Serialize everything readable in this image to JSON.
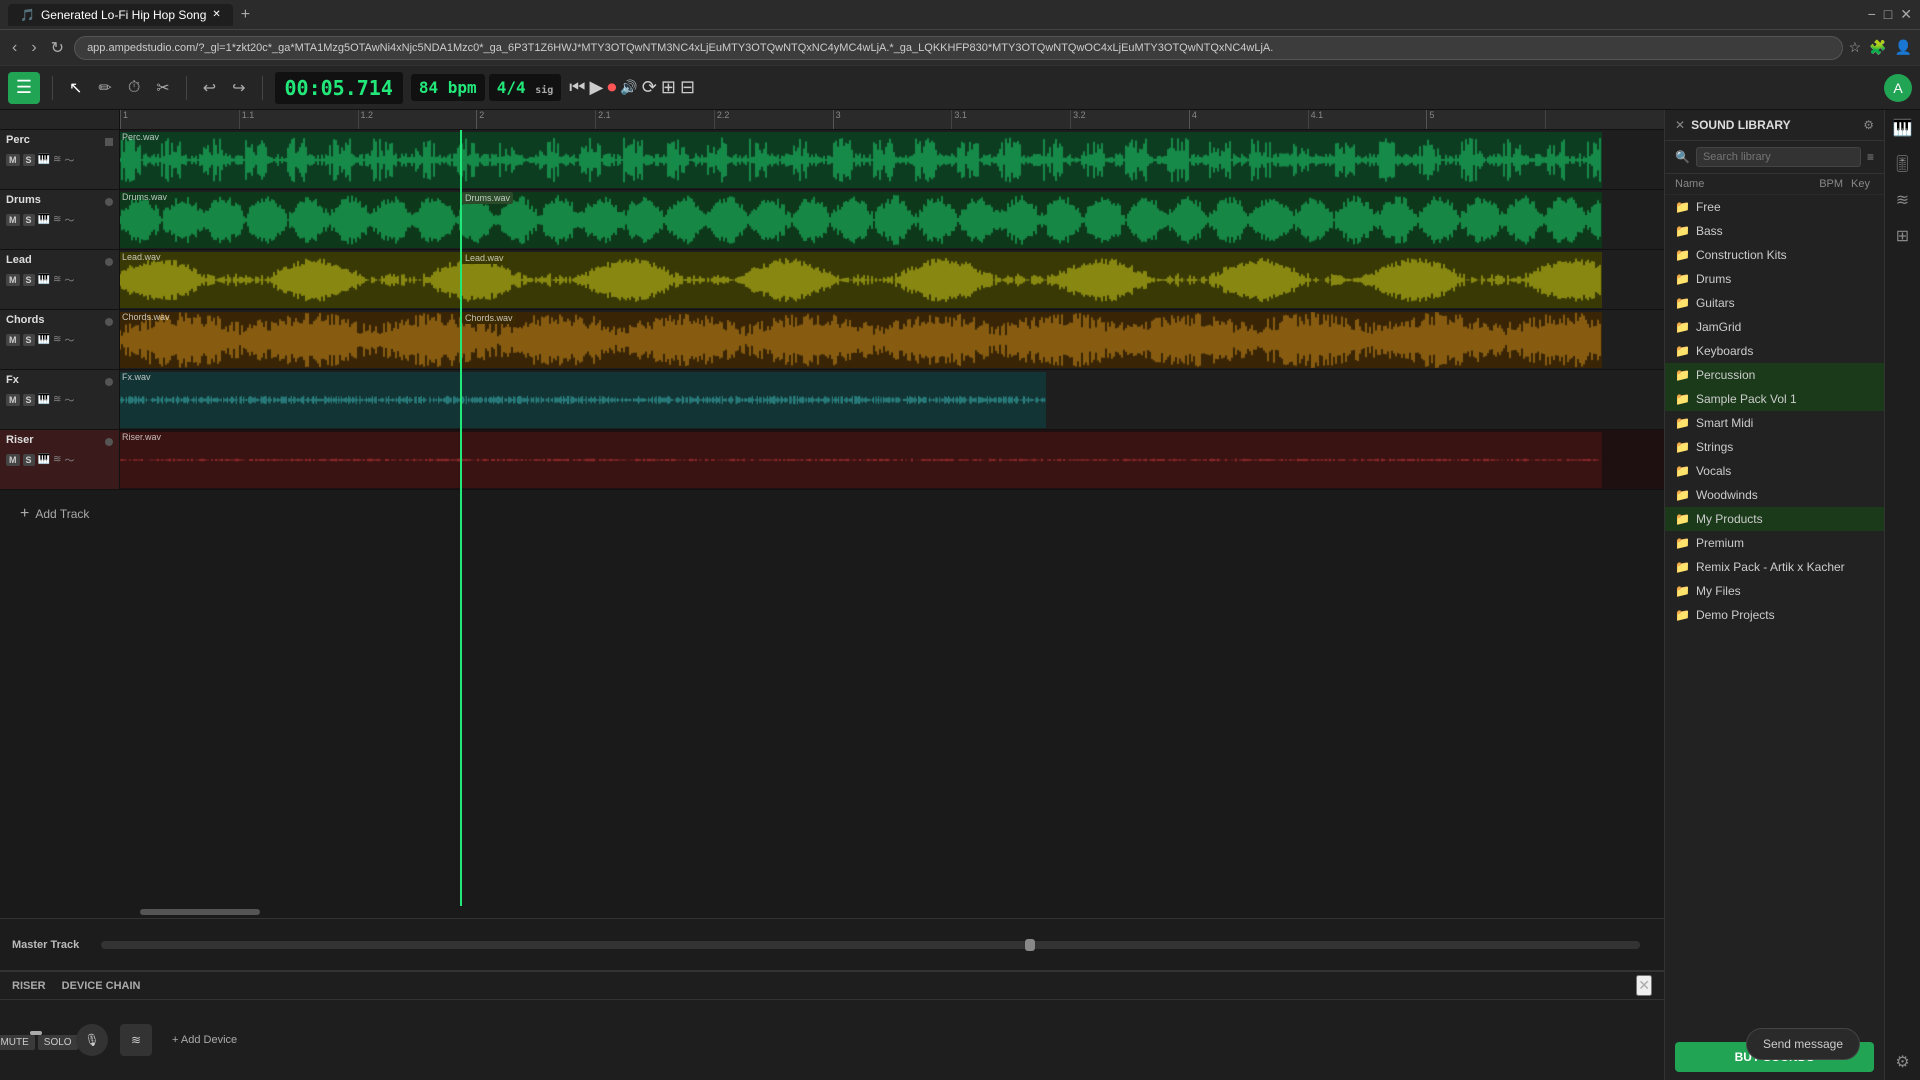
{
  "browser": {
    "tab_label": "Generated Lo-Fi Hip Hop Song",
    "url": "app.ampedstudio.com/?_gl=1*zkt20c*_ga*MTA1Mzg5OTAwNi4xNjc5NDA1Mzc0*_ga_6P3T1Z6HWJ*MTY3OTQwNTM3NC4xLjEuMTY3OTQwNTQxNC4yMC4wLjA.*_ga_LQKKHFP830*MTY3OTQwNTQwOC4xLjEuMTY3OTQwNTQxNC4wLjA.",
    "new_tab": "+",
    "minimize": "−",
    "maximize": "□",
    "close": "✕"
  },
  "toolbar": {
    "menu_icon": "☰",
    "select_tool": "↖",
    "pencil_tool": "✏",
    "time_tool": "⏱",
    "cut_tool": "✂",
    "undo": "↩",
    "redo": "↪",
    "time_display": "00:05.714",
    "bpm_label": "84 bpm",
    "sig_label": "4/4",
    "sig_sub": "sig",
    "rewind": "⏮",
    "play": "▶",
    "record": "⏺",
    "loop": "🔁",
    "metronome": "🎵",
    "grid": "⊞"
  },
  "tracks": [
    {
      "id": "perc",
      "name": "Perc",
      "clip_label": "Perc.wav",
      "type": "perc",
      "color": "#22e87a",
      "has_second_clip": false
    },
    {
      "id": "drums",
      "name": "Drums",
      "clip_label": "Drums.wav",
      "type": "drums",
      "color": "#22e87a",
      "has_second_clip": true,
      "second_clip_label": "Drums.wav"
    },
    {
      "id": "lead",
      "name": "Lead",
      "clip_label": "Lead.wav",
      "type": "lead",
      "color": "#e8e822",
      "has_second_clip": true,
      "second_clip_label": "Lead.wav"
    },
    {
      "id": "chords",
      "name": "Chords",
      "clip_label": "Chords.wav",
      "type": "chords",
      "color": "#e8a022",
      "has_second_clip": true,
      "second_clip_label": "Chords.wav"
    },
    {
      "id": "fx",
      "name": "Fx",
      "clip_label": "Fx.wav",
      "type": "fx",
      "color": "#44cccc",
      "has_second_clip": false
    },
    {
      "id": "riser",
      "name": "Riser",
      "clip_label": "Riser.wav",
      "type": "riser",
      "color": "#e84444",
      "has_second_clip": false,
      "selected": true
    }
  ],
  "add_track": {
    "icon": "+",
    "label": "Add Track"
  },
  "master_track": {
    "label": "Master Track"
  },
  "bottom_panel": {
    "track_label": "RISER",
    "device_chain_label": "DEVICE CHAIN",
    "close_icon": "✕",
    "mute_label": "MUTE",
    "solo_label": "SOLO",
    "add_device_label": "+ Add Device"
  },
  "sound_library": {
    "title": "SOUND LIBRARY",
    "close_icon": "✕",
    "search_placeholder": "Search library",
    "col_name": "Name",
    "col_bpm": "BPM",
    "col_key": "Key",
    "items": [
      {
        "id": "free",
        "label": "Free"
      },
      {
        "id": "bass",
        "label": "Bass"
      },
      {
        "id": "construction-kits",
        "label": "Construction Kits"
      },
      {
        "id": "drums",
        "label": "Drums"
      },
      {
        "id": "guitars",
        "label": "Guitars"
      },
      {
        "id": "jamgrid",
        "label": "JamGrid"
      },
      {
        "id": "keyboards",
        "label": "Keyboards"
      },
      {
        "id": "percussion",
        "label": "Percussion"
      },
      {
        "id": "sample-pack-vol1",
        "label": "Sample Pack Vol 1"
      },
      {
        "id": "smart-midi",
        "label": "Smart Midi"
      },
      {
        "id": "strings",
        "label": "Strings"
      },
      {
        "id": "vocals",
        "label": "Vocals"
      },
      {
        "id": "woodwinds",
        "label": "Woodwinds"
      },
      {
        "id": "my-products",
        "label": "My Products"
      },
      {
        "id": "premium",
        "label": "Premium"
      },
      {
        "id": "remix-pack",
        "label": "Remix Pack - Artik x Kacher"
      },
      {
        "id": "my-files",
        "label": "My Files"
      },
      {
        "id": "demo-projects",
        "label": "Demo Projects"
      }
    ],
    "buy_sounds_label": "BUY SOUNDS"
  },
  "send_message": {
    "label": "Send message"
  },
  "colors": {
    "accent_green": "#22a455",
    "waveform_green": "#22e87a",
    "waveform_yellow": "#e8e822",
    "waveform_orange": "#e8a022",
    "waveform_red": "#e84444",
    "bg_dark": "#1a1a1a",
    "bg_medium": "#252525"
  }
}
